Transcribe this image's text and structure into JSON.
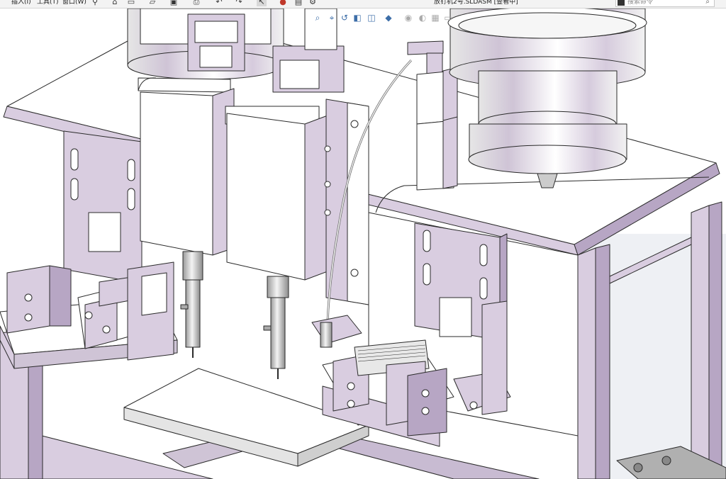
{
  "menu": {
    "insert": "插入(I)",
    "tools": "工具(T)",
    "window": "窗口(W)"
  },
  "title_bar": {
    "document_title": "放钉机2号.SLDASM [查看中]"
  },
  "search": {
    "placeholder": "搜索命令"
  },
  "icons": {
    "quick_access": [
      "pin-icon",
      "home-icon",
      "new-document-icon",
      "open-icon",
      "save-icon",
      "print-icon",
      "undo-icon",
      "redo-icon",
      "select-icon",
      "traffic-light-icon",
      "file-properties-icon",
      "options-gear-icon"
    ],
    "heads_up": [
      "zoom-to-fit-icon",
      "zoom-area-icon",
      "previous-view-icon",
      "section-view-icon",
      "view-orientation-icon",
      "display-style-icon",
      "hide-show-items-icon",
      "edit-appearance-icon",
      "apply-scene-icon",
      "view-settings-icon"
    ]
  },
  "colors": {
    "part_lilac": "#d9cde0",
    "part_lilac_dark": "#b7a6c4",
    "white_part": "#ffffff",
    "edge": "#2b2b2b",
    "toolbar_bg": "#f3f3f3"
  }
}
